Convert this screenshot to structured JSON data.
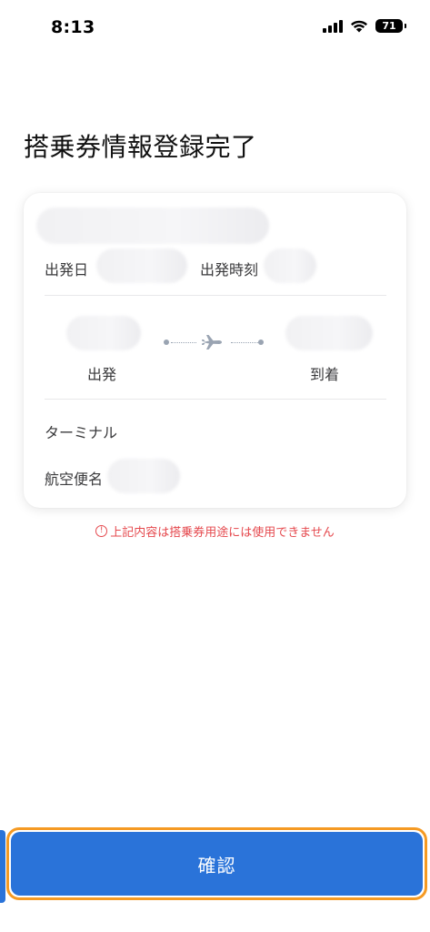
{
  "status_bar": {
    "time": "8:13",
    "battery": "71"
  },
  "page": {
    "title": "搭乗券情報登録完了"
  },
  "card": {
    "departure_date_label": "出発日",
    "departure_time_label": "出発時刻",
    "departure_label": "出発",
    "arrival_label": "到着",
    "terminal_label": "ターミナル",
    "flight_number_label": "航空便名"
  },
  "notice": {
    "icon": "!",
    "text": "上記内容は搭乗券用途には使用できません"
  },
  "footer": {
    "confirm_label": "確認"
  },
  "colors": {
    "primary": "#2a73d9",
    "highlight": "#f59a23",
    "warning": "#e5484d"
  }
}
